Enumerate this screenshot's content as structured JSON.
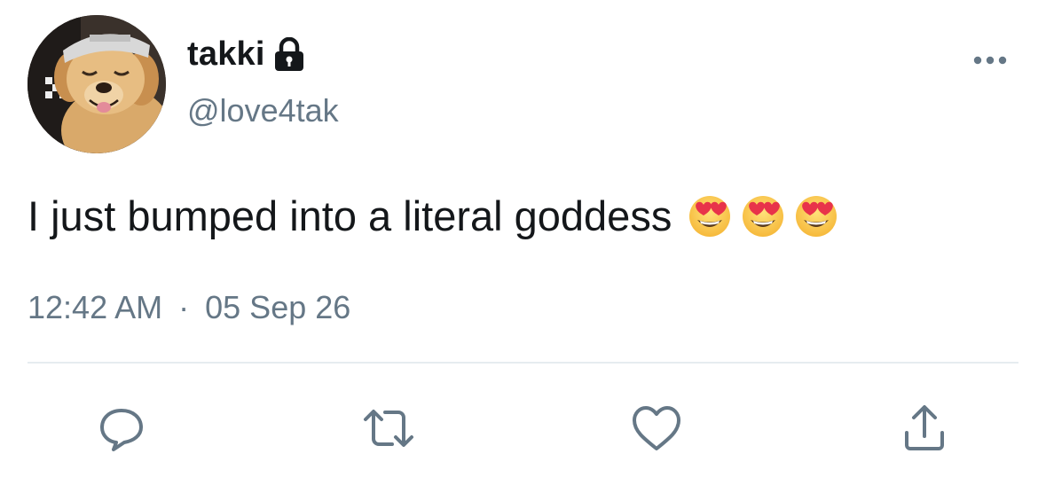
{
  "user": {
    "display_name": "takki",
    "handle": "@love4tak",
    "avatar": "avatar-dog-photo",
    "protected_icon": "lock-icon"
  },
  "tweet": {
    "text": "I just bumped into a literal goddess",
    "emojis": [
      "heart-eyes-emoji",
      "heart-eyes-emoji",
      "heart-eyes-emoji"
    ],
    "time": "12:42 AM",
    "separator": "·",
    "date": "05 Sep 26"
  },
  "actions": [
    {
      "name": "reply",
      "icon": "reply-icon"
    },
    {
      "name": "retweet",
      "icon": "retweet-icon"
    },
    {
      "name": "like",
      "icon": "heart-icon"
    },
    {
      "name": "share",
      "icon": "share-icon"
    }
  ],
  "colors": {
    "text_primary": "#14171a",
    "text_secondary": "#657786",
    "divider": "#e6ecf0",
    "action_icon": "#657786"
  }
}
